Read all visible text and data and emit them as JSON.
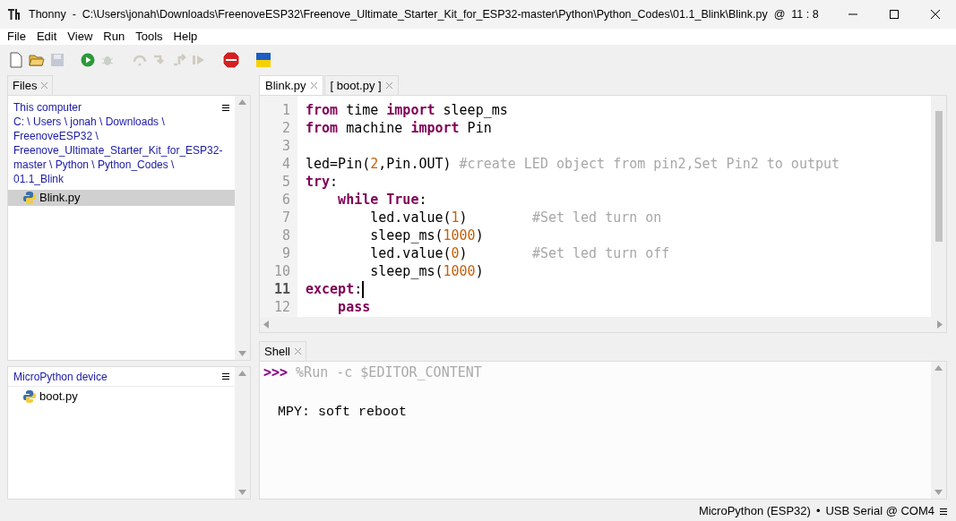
{
  "window": {
    "title": "Thonny  -  C:\\Users\\jonah\\Downloads\\FreenoveESP32\\Freenove_Ultimate_Starter_Kit_for_ESP32-master\\Python\\Python_Codes\\01.1_Blink\\Blink.py  @  11 : 8"
  },
  "menu": [
    "File",
    "Edit",
    "View",
    "Run",
    "Tools",
    "Help"
  ],
  "files_panel": {
    "tab": "Files",
    "local": {
      "title": "This computer",
      "path": "C: \\ Users \\ jonah \\ Downloads \\ FreenoveESP32 \\ Freenove_Ultimate_Starter_Kit_for_ESP32-master \\ Python \\ Python_Codes \\ 01.1_Blink",
      "files": [
        {
          "name": "Blink.py",
          "selected": true
        }
      ]
    },
    "device": {
      "title": "MicroPython device",
      "files": [
        {
          "name": "boot.py",
          "selected": false
        }
      ]
    }
  },
  "editor": {
    "tabs": [
      {
        "label": "Blink.py",
        "selected": true
      },
      {
        "label": "[ boot.py ]",
        "selected": false
      }
    ],
    "lines": [
      {
        "number": "1",
        "current": false,
        "tokens": [
          {
            "kind": "keyword",
            "text": "from"
          },
          {
            "kind": "plain",
            "text": " time "
          },
          {
            "kind": "keyword",
            "text": "import"
          },
          {
            "kind": "plain",
            "text": " sleep_ms"
          }
        ]
      },
      {
        "number": "2",
        "current": false,
        "tokens": [
          {
            "kind": "keyword",
            "text": "from"
          },
          {
            "kind": "plain",
            "text": " machine "
          },
          {
            "kind": "keyword",
            "text": "import"
          },
          {
            "kind": "plain",
            "text": " Pin"
          }
        ]
      },
      {
        "number": "3",
        "current": false
      },
      {
        "number": "4",
        "current": false,
        "tokens": [
          {
            "kind": "plain",
            "text": "led=Pin("
          },
          {
            "kind": "number",
            "text": "2"
          },
          {
            "kind": "plain",
            "text": ",Pin.OUT) "
          },
          {
            "kind": "comment",
            "text": "#create LED object from pin2,Set Pin2 to output"
          }
        ]
      },
      {
        "number": "5",
        "current": false,
        "tokens": [
          {
            "kind": "keyword",
            "text": "try"
          },
          {
            "kind": "plain",
            "text": ":"
          }
        ]
      },
      {
        "number": "6",
        "current": false,
        "tokens": [
          {
            "kind": "keyword",
            "text": "    while"
          },
          {
            "kind": "keyword",
            "text": " True"
          },
          {
            "kind": "plain",
            "text": ":"
          }
        ]
      },
      {
        "number": "7",
        "current": false,
        "tokens": [
          {
            "kind": "plain",
            "text": "        led.value("
          },
          {
            "kind": "number",
            "text": "1"
          },
          {
            "kind": "plain",
            "text": ")        "
          },
          {
            "kind": "comment",
            "text": "#Set led turn on"
          }
        ]
      },
      {
        "number": "8",
        "current": false,
        "tokens": [
          {
            "kind": "plain",
            "text": "        sleep_ms("
          },
          {
            "kind": "number",
            "text": "1000"
          },
          {
            "kind": "plain",
            "text": ")"
          }
        ]
      },
      {
        "number": "9",
        "current": false,
        "tokens": [
          {
            "kind": "plain",
            "text": "        led.value("
          },
          {
            "kind": "number",
            "text": "0"
          },
          {
            "kind": "plain",
            "text": ")        "
          },
          {
            "kind": "comment",
            "text": "#Set led turn off"
          }
        ]
      },
      {
        "number": "10",
        "current": false,
        "tokens": [
          {
            "kind": "plain",
            "text": "        sleep_ms("
          },
          {
            "kind": "number",
            "text": "1000"
          },
          {
            "kind": "plain",
            "text": ")"
          }
        ]
      },
      {
        "number": "11",
        "current": true,
        "tokens": [
          {
            "kind": "keyword",
            "text": "except"
          },
          {
            "kind": "plain",
            "text": ":"
          }
        ]
      },
      {
        "number": "12",
        "current": false,
        "tokens": [
          {
            "kind": "keyword",
            "text": "    pass"
          }
        ]
      }
    ]
  },
  "shell": {
    "tab": "Shell",
    "prompt": ">>>",
    "command": "%Run -c $EDITOR_CONTENT",
    "output": "MPY: soft reboot"
  },
  "status_bar": {
    "interpreter": "MicroPython (ESP32)",
    "separator": "•",
    "port": "USB Serial @ COM4"
  }
}
